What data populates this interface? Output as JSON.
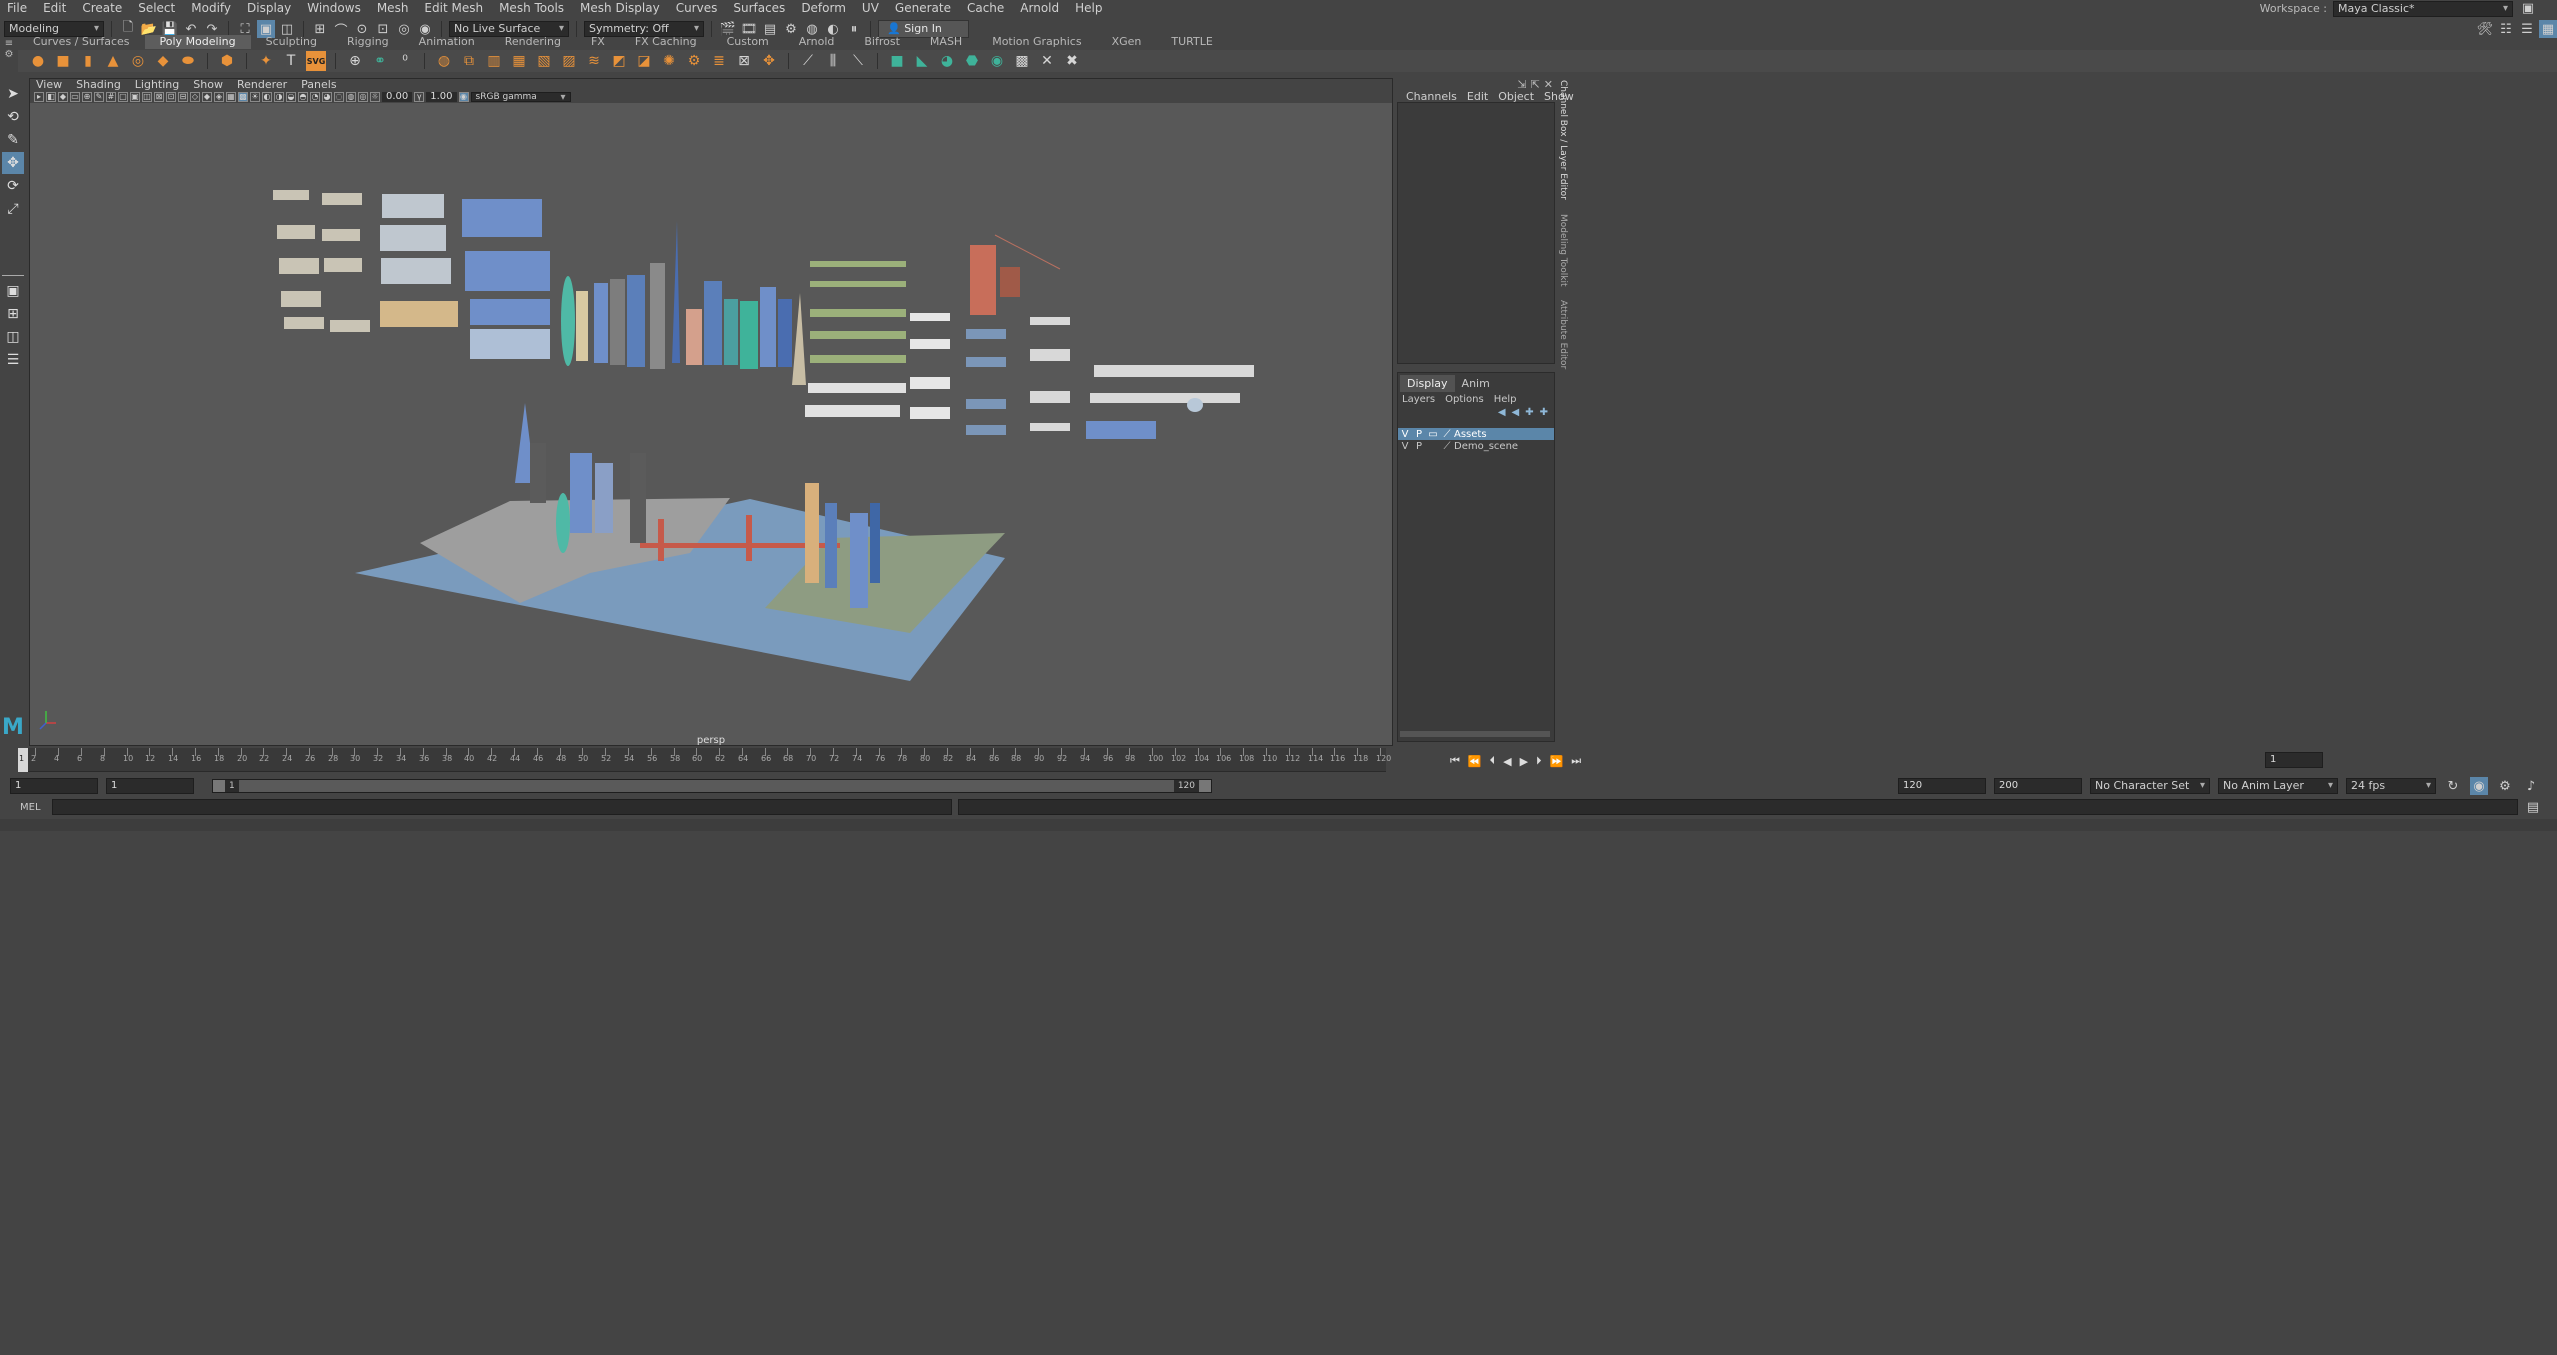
{
  "menubar": {
    "items": [
      "File",
      "Edit",
      "Create",
      "Select",
      "Modify",
      "Display",
      "Windows",
      "Mesh",
      "Edit Mesh",
      "Mesh Tools",
      "Mesh Display",
      "Curves",
      "Surfaces",
      "Deform",
      "UV",
      "Generate",
      "Cache",
      "Arnold",
      "Help"
    ],
    "workspace_label": "Workspace :",
    "workspace_value": "Maya Classic*"
  },
  "statusline": {
    "mode": "Modeling",
    "live_surface": "No Live Surface",
    "symmetry": "Symmetry: Off",
    "sign_in": "Sign In"
  },
  "shelf": {
    "tabs": [
      "Curves / Surfaces",
      "Poly Modeling",
      "Sculpting",
      "Rigging",
      "Animation",
      "Rendering",
      "FX",
      "FX Caching",
      "Custom",
      "Arnold",
      "Bifrost",
      "MASH",
      "Motion Graphics",
      "XGen",
      "TURTLE"
    ],
    "active_tab": "Poly Modeling",
    "svg_label": "SVG"
  },
  "viewport": {
    "menus": [
      "View",
      "Shading",
      "Lighting",
      "Show",
      "Renderer",
      "Panels"
    ],
    "exposure": "0.00",
    "gamma": "1.00",
    "color_space": "sRGB gamma",
    "camera": "persp"
  },
  "channelbox": {
    "menus": [
      "Channels",
      "Edit",
      "Object",
      "Show"
    ],
    "layer_tabs": [
      "Display",
      "Anim"
    ],
    "layer_menus": [
      "Layers",
      "Options",
      "Help"
    ],
    "layers": [
      {
        "v": "V",
        "p": "P",
        "name": "Assets",
        "selected": true
      },
      {
        "v": "V",
        "p": "P",
        "name": "Demo_scene",
        "selected": false
      }
    ],
    "side_tabs": [
      "Channel Box / Layer Editor",
      "Modeling Toolkit",
      "Attribute Editor"
    ]
  },
  "timeline": {
    "ticks": [
      "2",
      "4",
      "6",
      "8",
      "10",
      "12",
      "14",
      "16",
      "18",
      "20",
      "22",
      "24",
      "26",
      "28",
      "30",
      "32",
      "34",
      "36",
      "38",
      "40",
      "42",
      "44",
      "46",
      "48",
      "50",
      "52",
      "54",
      "56",
      "58",
      "60",
      "62",
      "64",
      "66",
      "68",
      "70",
      "72",
      "74",
      "76",
      "78",
      "80",
      "82",
      "84",
      "86",
      "88",
      "90",
      "92",
      "94",
      "96",
      "98",
      "100",
      "102",
      "104",
      "106",
      "108",
      "110",
      "112",
      "114",
      "116",
      "118",
      "120"
    ],
    "current_frame": "1",
    "frame_field": "1"
  },
  "range": {
    "start": "1",
    "start2": "1",
    "slider_start": "1",
    "slider_end": "120",
    "end": "120",
    "end2": "200",
    "character_set": "No Character Set",
    "anim_layer": "No Anim Layer",
    "fps": "24 fps"
  },
  "cmdline": {
    "label": "MEL"
  },
  "colors": {
    "accent": "#5b86a9",
    "shelf_orange": "#e8923a",
    "water": "#7a9bbd"
  }
}
